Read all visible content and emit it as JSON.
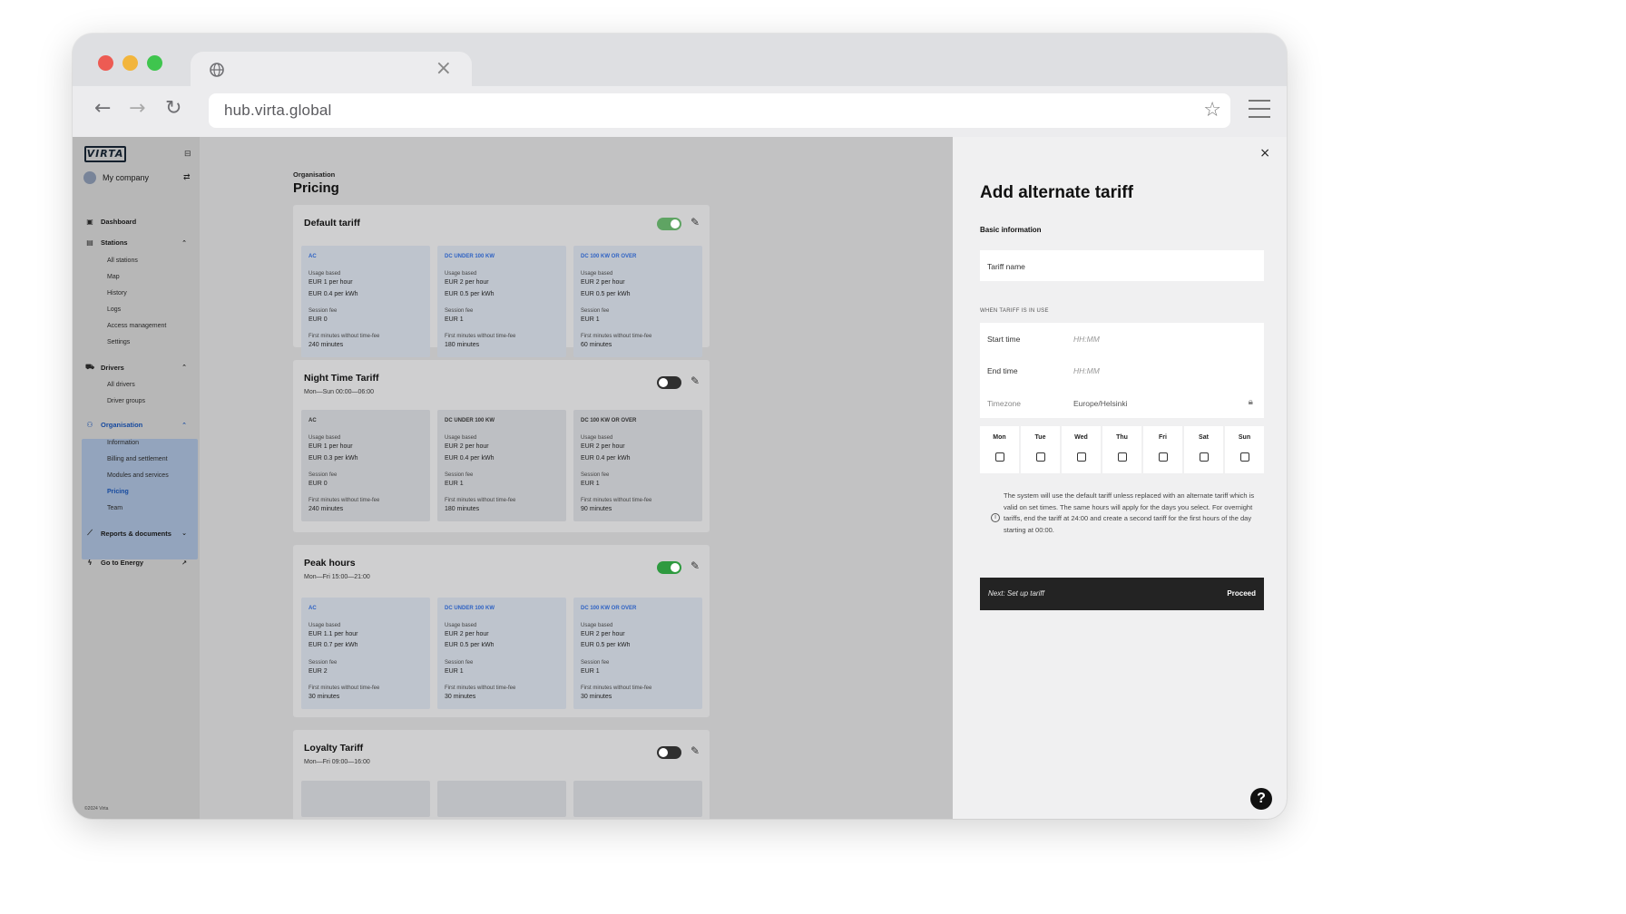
{
  "browser": {
    "url": "hub.virta.global",
    "tab_close": "×",
    "back": "←",
    "forward": "→",
    "reload": "↻",
    "star": "☆"
  },
  "sidebar": {
    "logo": "VIRTA",
    "company": "My company",
    "items": {
      "dashboard": "Dashboard",
      "stations": "Stations",
      "drivers": "Drivers",
      "organisation": "Organisation",
      "reports": "Reports & documents",
      "energy": "Go to Energy"
    },
    "station_subs": [
      "All stations",
      "Map",
      "History",
      "Logs",
      "Access management",
      "Settings"
    ],
    "driver_subs": [
      "All drivers",
      "Driver groups"
    ],
    "org_subs": [
      "Information",
      "Billing and settlement",
      "Modules and services",
      "Pricing",
      "Team"
    ],
    "footer": "©2024 Virta"
  },
  "main": {
    "breadcrumb": "Organisation",
    "title": "Pricing",
    "tariffs": [
      {
        "name": "Default tariff",
        "schedule": "",
        "enabled": true,
        "rates": [
          {
            "type": "AC",
            "usage_label": "Usage based",
            "line1": "EUR 1 per hour",
            "line2": "EUR 0.4 per kWh",
            "session_label": "Session fee",
            "session": "EUR 0",
            "free_label": "First minutes without time-fee",
            "free": "240 minutes"
          },
          {
            "type": "DC UNDER 100 KW",
            "usage_label": "Usage based",
            "line1": "EUR 2 per hour",
            "line2": "EUR 0.5 per kWh",
            "session_label": "Session fee",
            "session": "EUR 1",
            "free_label": "First minutes without time-fee",
            "free": "180 minutes"
          },
          {
            "type": "DC 100 KW OR OVER",
            "usage_label": "Usage based",
            "line1": "EUR 2 per hour",
            "line2": "EUR 0.5 per kWh",
            "session_label": "Session fee",
            "session": "EUR 1",
            "free_label": "First minutes without time-fee",
            "free": "60 minutes"
          }
        ]
      },
      {
        "name": "Night Time Tariff",
        "schedule": "Mon—Sun 00:00—06:00",
        "enabled": false,
        "rates": [
          {
            "type": "AC",
            "usage_label": "Usage based",
            "line1": "EUR 1 per hour",
            "line2": "EUR 0.3 per kWh",
            "session_label": "Session fee",
            "session": "EUR 0",
            "free_label": "First minutes without time-fee",
            "free": "240 minutes"
          },
          {
            "type": "DC UNDER 100 KW",
            "usage_label": "Usage based",
            "line1": "EUR 2 per hour",
            "line2": "EUR 0.4 per kWh",
            "session_label": "Session fee",
            "session": "EUR 1",
            "free_label": "First minutes without time-fee",
            "free": "180 minutes"
          },
          {
            "type": "DC 100 KW OR OVER",
            "usage_label": "Usage based",
            "line1": "EUR 2 per hour",
            "line2": "EUR 0.4 per kWh",
            "session_label": "Session fee",
            "session": "EUR 1",
            "free_label": "First minutes without time-fee",
            "free": "90 minutes"
          }
        ]
      },
      {
        "name": "Peak hours",
        "schedule": "Mon—Fri 15:00—21:00",
        "enabled": true,
        "rates": [
          {
            "type": "AC",
            "usage_label": "Usage based",
            "line1": "EUR 1.1 per hour",
            "line2": "EUR 0.7 per kWh",
            "session_label": "Session fee",
            "session": "EUR 2",
            "free_label": "First minutes without time-fee",
            "free": "30 minutes"
          },
          {
            "type": "DC UNDER 100 KW",
            "usage_label": "Usage based",
            "line1": "EUR 2 per hour",
            "line2": "EUR 0.5 per kWh",
            "session_label": "Session fee",
            "session": "EUR 1",
            "free_label": "First minutes without time-fee",
            "free": "30 minutes"
          },
          {
            "type": "DC 100 KW OR OVER",
            "usage_label": "Usage based",
            "line1": "EUR 2 per hour",
            "line2": "EUR 0.5 per kWh",
            "session_label": "Session fee",
            "session": "EUR 1",
            "free_label": "First minutes without time-fee",
            "free": "30 minutes"
          }
        ]
      },
      {
        "name": "Loyalty Tariff",
        "schedule": "Mon—Fri 09:00—16:00",
        "enabled": false
      }
    ]
  },
  "panel": {
    "close": "×",
    "title": "Add alternate tariff",
    "section": "Basic information",
    "tariff_name_placeholder": "Tariff name",
    "when_label": "WHEN TARIFF IS IN USE",
    "start_label": "Start time",
    "start_placeholder": "HH:MM",
    "end_label": "End time",
    "end_placeholder": "HH:MM",
    "timezone_label": "Timezone",
    "timezone_value": "Europe/Helsinki",
    "days": [
      "Mon",
      "Tue",
      "Wed",
      "Thu",
      "Fri",
      "Sat",
      "Sun"
    ],
    "info": "The system will use the default tariff unless replaced with an alternate tariff which is valid on set times. The same hours will apply for the days you select. For overnight tariffs, end the tariff at 24:00 and create a second tariff for the first hours of the day starting at 00:00.",
    "next_label": "Next: Set up tariff",
    "proceed": "Proceed",
    "help": "?"
  },
  "colors": {
    "accent_blue": "#2f63c4",
    "toggle_on": "#2e9a3f",
    "toggle_off": "#2f2f2f",
    "dark_button": "#232323"
  }
}
